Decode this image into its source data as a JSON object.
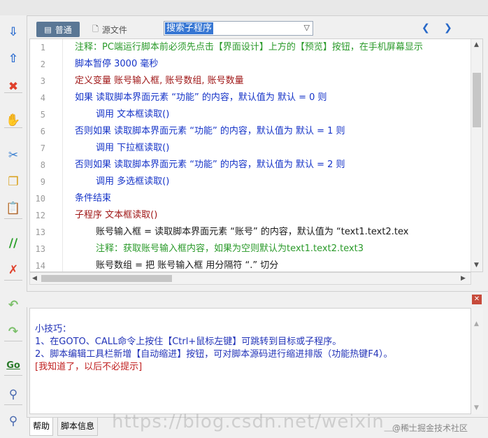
{
  "toolbar": {
    "buttons": [
      {
        "name": "move-down-icon",
        "glyph": "⇩",
        "color": "#2f6fd0"
      },
      {
        "name": "move-up-icon",
        "glyph": "⇧",
        "color": "#2f6fd0"
      },
      {
        "name": "delete-icon",
        "glyph": "✖",
        "color": "#e0412c"
      },
      {
        "name": "hand-icon",
        "glyph": "✋",
        "color": "#e08a1c"
      },
      {
        "name": "cut-icon",
        "glyph": "✂",
        "color": "#3a7fd0"
      },
      {
        "name": "copy-icon",
        "glyph": "❐",
        "color": "#d8a018"
      },
      {
        "name": "paste-icon",
        "glyph": "📋",
        "color": "#c08a3a"
      },
      {
        "name": "comment-icon",
        "glyph": "//",
        "color": "#2aa02a"
      },
      {
        "name": "uncomment-icon",
        "glyph": "✗",
        "color": "#e0412c"
      },
      {
        "name": "undo-icon",
        "glyph": "↶",
        "color": "#7bbf6a"
      },
      {
        "name": "redo-icon",
        "glyph": "↷",
        "color": "#7bbf6a"
      },
      {
        "name": "goto-icon",
        "glyph": "Go",
        "color": "#2a7a2a"
      },
      {
        "name": "find-icon",
        "glyph": "⚲",
        "color": "#4a6ab0"
      },
      {
        "name": "replace-icon",
        "glyph": "⚲",
        "color": "#4a6ab0"
      }
    ]
  },
  "tabs": {
    "normal": "普通",
    "source": "源文件"
  },
  "subroutine_combo": {
    "value": "搜索子程序"
  },
  "nav": {
    "prev": "❮",
    "next": "❯"
  },
  "code_lines": [
    {
      "num": "1",
      "text": "注释：PC端运行脚本前必须先点击【界面设计】上方的【预览】按钮，在手机屏幕显示",
      "color": "green",
      "indent": false
    },
    {
      "num": "2",
      "text": "脚本暂停 3000 毫秒",
      "color": "blue",
      "indent": false
    },
    {
      "num": "3",
      "text": "定义变量 账号输入框, 账号数组, 账号数量",
      "color": "red",
      "indent": false
    },
    {
      "num": "4",
      "text": "如果 读取脚本界面元素 “功能” 的内容，默认值为 默认 = 0 则",
      "color": "blue",
      "indent": false
    },
    {
      "num": "5",
      "text": "调用 文本框读取()",
      "color": "blue",
      "indent": true
    },
    {
      "num": "6",
      "text": "否则如果 读取脚本界面元素 “功能” 的内容，默认值为 默认 = 1 则",
      "color": "blue",
      "indent": false
    },
    {
      "num": "7",
      "text": "调用 下拉框读取()",
      "color": "blue",
      "indent": true
    },
    {
      "num": "8",
      "text": "否则如果 读取脚本界面元素 “功能” 的内容，默认值为 默认 = 2 则",
      "color": "blue",
      "indent": false
    },
    {
      "num": "9",
      "text": "调用 多选框读取()",
      "color": "blue",
      "indent": true
    },
    {
      "num": "10",
      "text": "条件结束",
      "color": "blue",
      "indent": false
    },
    {
      "num": "12",
      "text": "子程序 文本框读取()",
      "color": "red",
      "indent": false
    },
    {
      "num": "13",
      "text": "账号输入框 = 读取脚本界面元素 “账号” 的内容，默认值为 “text1.text2.tex",
      "color": "black",
      "indent": true
    },
    {
      "num": "13",
      "text": "注释：获取账号输入框内容，如果为空则默认为text1.text2.text3",
      "color": "green",
      "indent": true
    },
    {
      "num": "14",
      "text": "账号数组 = 把 账号输入框 用分隔符 “.” 切分",
      "color": "black",
      "indent": true
    }
  ],
  "tips": {
    "title": "小技巧：",
    "line1": "1、在GOTO、CALL命令上按住【Ctrl+鼠标左键】可跳转到目标或子程序。",
    "line2": "2、脚本编辑工具栏新增【自动缩进】按钮，可对脚本源码进行缩进排版（功能热键F4）。",
    "dismiss": "[我知道了，以后不必提示]"
  },
  "bottom_tabs": {
    "help": "帮助",
    "script_info": "脚本信息"
  },
  "watermark": "https://blog.csdn.net/weixin_...",
  "credit": "@稀土掘金技术社区"
}
